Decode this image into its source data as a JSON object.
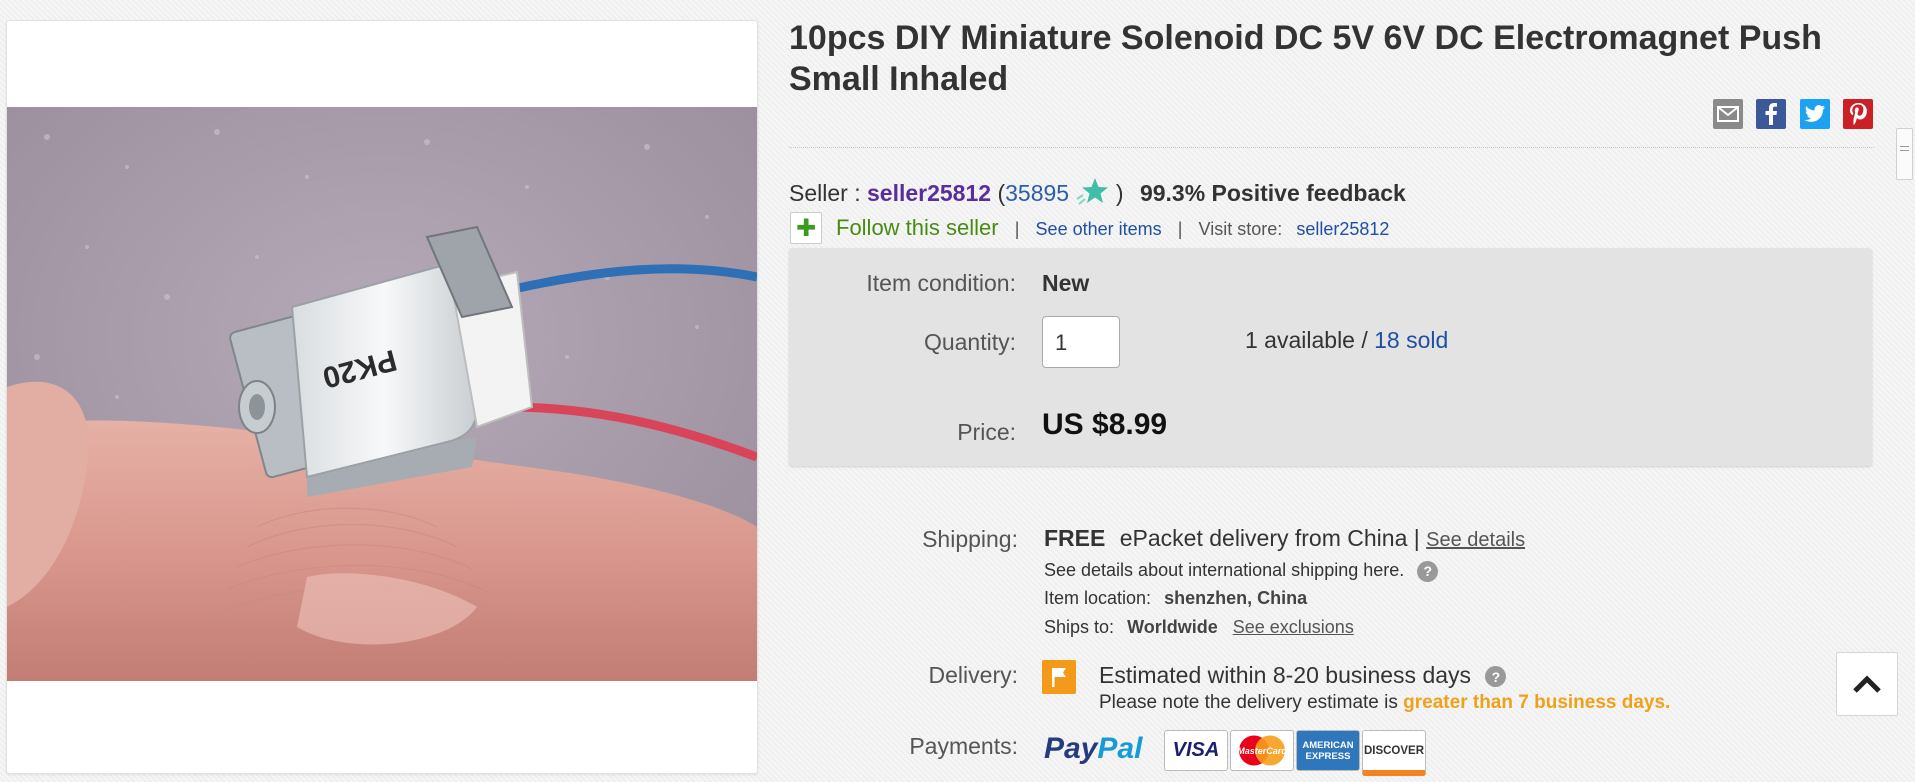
{
  "product": {
    "title": "10pcs DIY Miniature Solenoid DC 5V 6V DC Electromagnet Push Small Inhaled",
    "image_label": "PK20"
  },
  "share": {
    "icons": [
      "email-icon",
      "facebook-icon",
      "twitter-icon",
      "pinterest-icon"
    ],
    "colors": {
      "email": "#777777",
      "facebook": "#3b5998",
      "twitter": "#1da1f2",
      "pinterest": "#cb2027"
    }
  },
  "seller": {
    "label": "Seller :",
    "name": "seller25812",
    "open_paren": "(",
    "score": "35895",
    "close_paren": ")",
    "feedback": "99.3% Positive feedback",
    "follow_label": "Follow this seller",
    "sep1": "|",
    "see_other": "See other items",
    "sep2": "|",
    "visit_store_label": "Visit store:",
    "store_name": "seller25812",
    "star_color": "#3fbfa9"
  },
  "item": {
    "condition_label": "Item condition:",
    "condition_value": "New",
    "quantity_label": "Quantity:",
    "quantity_value": "1",
    "available": "1 available /",
    "sold": "18 sold",
    "price_label": "Price:",
    "price_value": "US $8.99"
  },
  "shipping": {
    "label": "Shipping:",
    "free": "FREE",
    "method": "ePacket delivery from China |",
    "see_details": "See details",
    "intl_note": "See details about international shipping here.",
    "location_label": "Item location:",
    "location_value": "shenzhen, China",
    "ships_to_label": "Ships to:",
    "ships_to_value": "Worldwide",
    "see_exclusions": "See exclusions",
    "help_glyph": "?"
  },
  "delivery": {
    "label": "Delivery:",
    "estimate": "Estimated within 8-20 business days",
    "note": "Please note the delivery estimate is",
    "note_highlight": "greater than 7 business days.",
    "help_glyph": "?",
    "flag_color": "#f39a1a"
  },
  "payments": {
    "label": "Payments:",
    "paypal_part1": "Pay",
    "paypal_part2": "Pal",
    "cards": [
      "VISA",
      "MasterCard",
      "AMERICAN EXPRESS",
      "DISCOVER"
    ]
  },
  "ui": {
    "back_to_top_icon": "chevron-up-icon"
  }
}
